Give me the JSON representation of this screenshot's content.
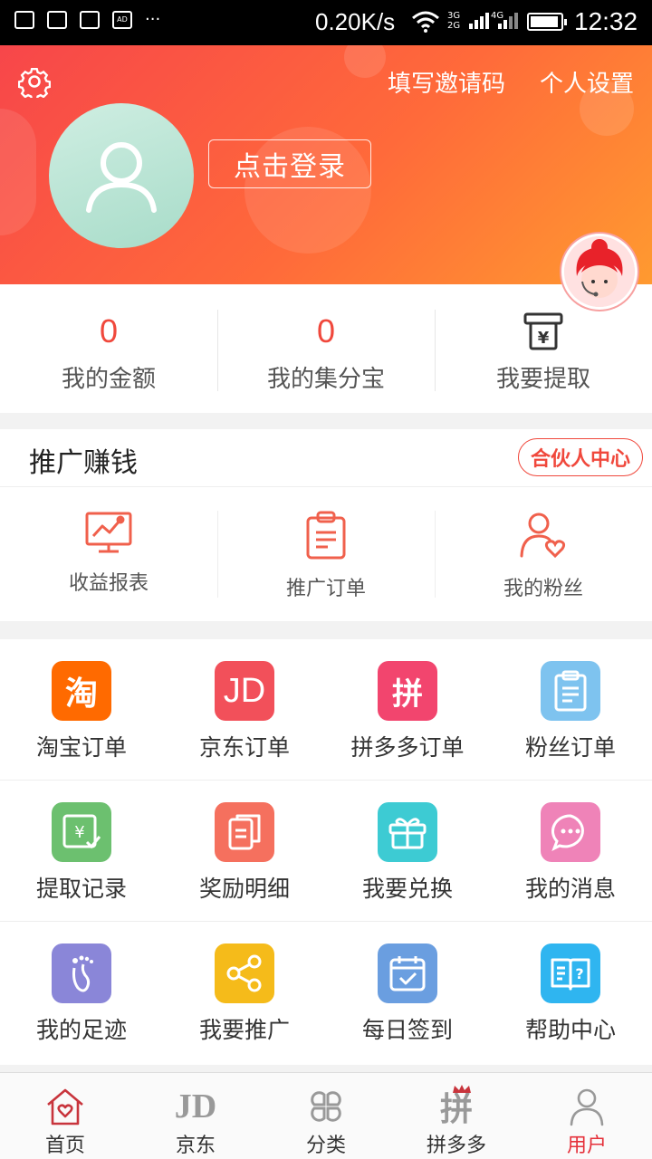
{
  "status_bar": {
    "speed": "0.20K/s",
    "time": "12:32",
    "net1": "3G",
    "net2": "2G",
    "net3": "4G",
    "ad_badge": "AD",
    "more": "···"
  },
  "header": {
    "invite_label": "填写邀请码",
    "settings_label": "个人设置",
    "login_label": "点击登录",
    "gradient_colors": [
      "#f7464a",
      "#ff6a3a",
      "#ff9a30"
    ]
  },
  "stats": {
    "balance_value": "0",
    "balance_label": "我的金额",
    "points_value": "0",
    "points_label": "我的集分宝",
    "withdraw_label": "我要提取"
  },
  "promo": {
    "title": "推广赚钱",
    "partner_label": "合伙人中心",
    "items": [
      {
        "label": "收益报表",
        "icon": "chart-icon"
      },
      {
        "label": "推广订单",
        "icon": "clipboard-icon"
      },
      {
        "label": "我的粉丝",
        "icon": "user-heart-icon"
      }
    ]
  },
  "grid": {
    "items": [
      {
        "label": "淘宝订单",
        "icon": "taobao-icon",
        "glyph": "淘",
        "color": "#ff6a00"
      },
      {
        "label": "京东订单",
        "icon": "jd-icon",
        "glyph": "JD",
        "color": "#f2505a"
      },
      {
        "label": "拼多多订单",
        "icon": "pinduoduo-icon",
        "glyph": "拼",
        "color": "#f2456e"
      },
      {
        "label": "粉丝订单",
        "icon": "clipboard-icon",
        "color": "#7ec3ef"
      },
      {
        "label": "提取记录",
        "icon": "withdraw-record-icon",
        "glyph": "¥",
        "color": "#6cc06f"
      },
      {
        "label": "奖励明细",
        "icon": "document-icon",
        "color": "#f5705e"
      },
      {
        "label": "我要兑换",
        "icon": "gift-icon",
        "color": "#3dcbd3"
      },
      {
        "label": "我的消息",
        "icon": "message-icon",
        "color": "#ef83b8"
      },
      {
        "label": "我的足迹",
        "icon": "footprint-icon",
        "color": "#8a86d8"
      },
      {
        "label": "我要推广",
        "icon": "share-icon",
        "color": "#f5bb1a"
      },
      {
        "label": "每日签到",
        "icon": "calendar-icon",
        "color": "#6a9ee0"
      },
      {
        "label": "帮助中心",
        "icon": "help-book-icon",
        "color": "#2fb5f0"
      }
    ]
  },
  "bottom_nav": {
    "items": [
      {
        "label": "首页",
        "icon": "home-icon"
      },
      {
        "label": "京东",
        "icon": "jd-icon",
        "glyph": "JD"
      },
      {
        "label": "分类",
        "icon": "category-icon"
      },
      {
        "label": "拼多多",
        "icon": "pinduoduo-icon",
        "glyph": "拼"
      },
      {
        "label": "用户",
        "icon": "user-icon",
        "active": true
      }
    ],
    "active_color": "#e5303a"
  }
}
